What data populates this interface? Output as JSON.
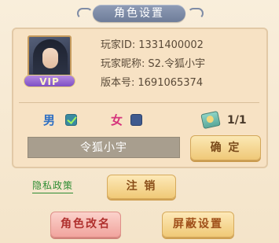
{
  "title": "角色设置",
  "profile": {
    "vip_badge": "VIP",
    "player_id_label": "玩家ID:",
    "player_id": "1331400002",
    "nickname_label": "玩家昵称:",
    "nickname": "S2.令狐小宇",
    "version_label": "版本号:",
    "version": "1691065374"
  },
  "gender": {
    "male_label": "男",
    "female_label": "女",
    "selected": "男"
  },
  "rename_card": {
    "icon": "book-icon",
    "count": "1/1"
  },
  "name_input": {
    "value": "令狐小宇"
  },
  "buttons": {
    "confirm": "确 定",
    "logout": "注 销",
    "rename": "角色改名",
    "block_settings": "屏蔽设置"
  },
  "links": {
    "privacy": "隐私政策"
  }
}
